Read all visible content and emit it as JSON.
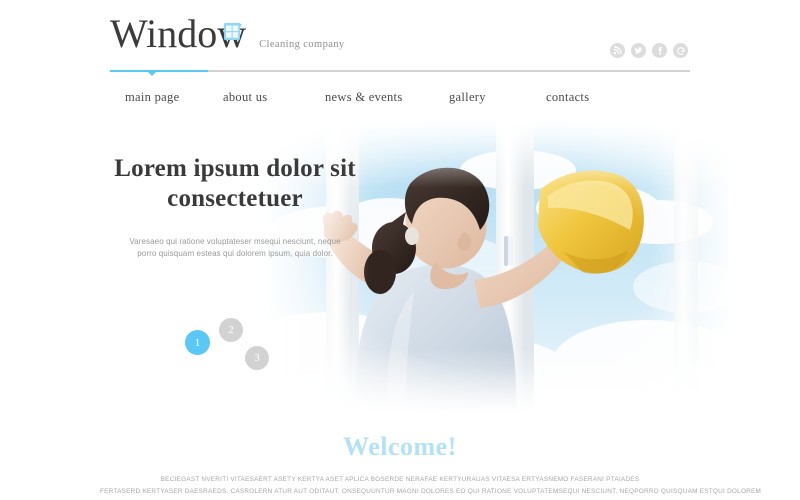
{
  "brand": {
    "name": "Window",
    "tagline": "Cleaning company",
    "logo_icon": "window-grid-icon",
    "accent_color": "#5ac8f5",
    "logo_icon_color": "#7fd4f2"
  },
  "social": [
    {
      "name": "rss",
      "label": "RSS",
      "icon": "rss-icon"
    },
    {
      "name": "twitter",
      "label": "Twitter",
      "icon": "twitter-bird-icon"
    },
    {
      "name": "facebook",
      "label": "Facebook",
      "icon": "facebook-f-icon"
    },
    {
      "name": "google-plus",
      "label": "Google",
      "icon": "google-g-icon"
    }
  ],
  "nav": {
    "items": [
      {
        "label": "main page",
        "active": true
      },
      {
        "label": "about us",
        "active": false
      },
      {
        "label": "news & events",
        "active": false
      },
      {
        "label": "gallery",
        "active": false
      },
      {
        "label": "contacts",
        "active": false
      }
    ]
  },
  "hero": {
    "title_line1": "Lorem ipsum dolor sit",
    "title_line2": "consectetuer",
    "paragraph": "Varesaeo qui ratione voluptateser msequi nesciunt, neque porro quisquam esteas qui dolorem ipsum, quia dolor.",
    "image_alt": "woman-cleaning-window-photo",
    "slides": [
      {
        "number": "1",
        "active": true
      },
      {
        "number": "2",
        "active": false
      },
      {
        "number": "3",
        "active": false
      }
    ]
  },
  "welcome": {
    "heading": "Welcome!",
    "line1": "BECIEGAST NVERITI VITAESAERT ASETY KERTYA ASET APLICA BOSERDE NERAFAE KERTYURAUAS VITAESA ERTYASNEMO FASERANI PTAIADES",
    "line2": "FERTASERD KERTYASER DAESRAEDS. CASROLERN ATUR AUT ODITAUT. ONSEQUUNTUR MAGNI DOLORES EO QUI RATIONE VOLUPTATEMSEQUI NESCIUNT, NEQPORRO QUISQUAM ESTQUI DOLOREM"
  }
}
